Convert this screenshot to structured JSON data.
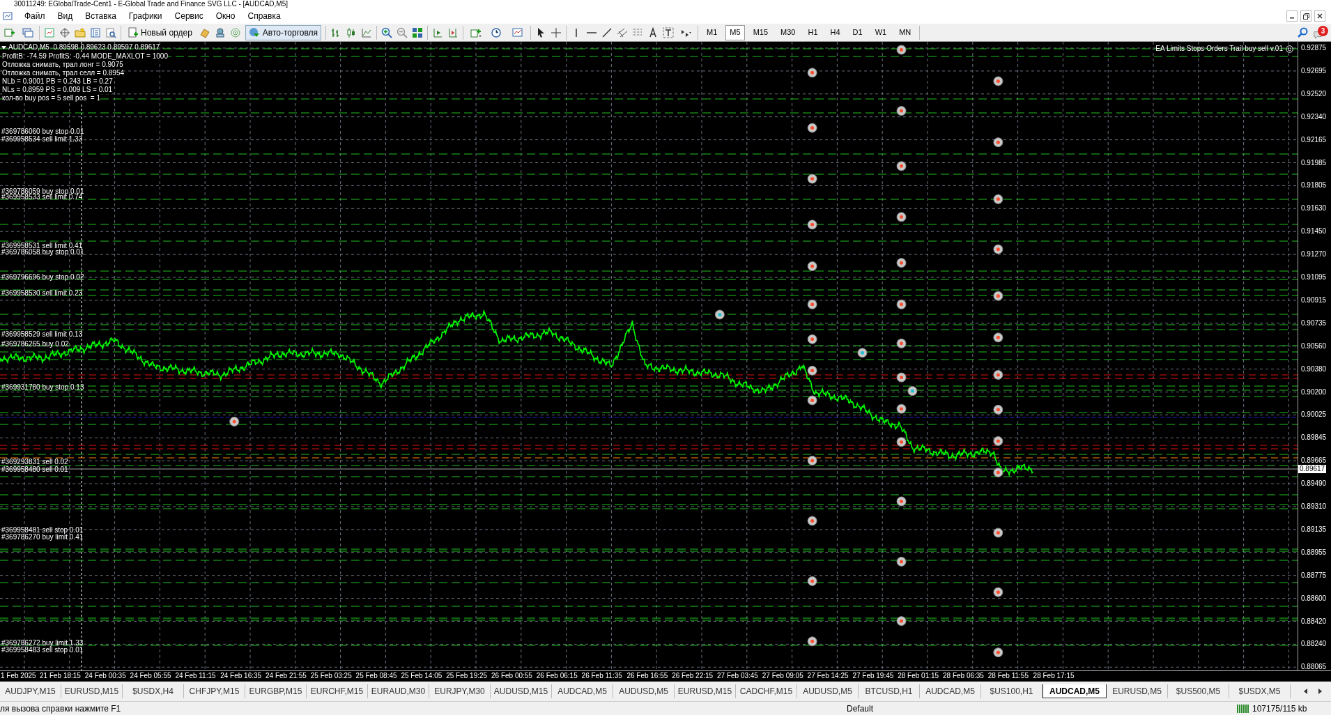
{
  "window": {
    "title": "30011249: EGlobalTrade-Cent1 - E-Global Trade and Finance SVG LLC - [AUDCAD,M5]"
  },
  "menu": [
    "Файл",
    "Вид",
    "Вставка",
    "Графики",
    "Сервис",
    "Окно",
    "Справка"
  ],
  "toolbar": {
    "new_order": "Новый ордер",
    "auto_trading": "Авто-торговля",
    "notifications": "3",
    "timeframes": [
      {
        "label": "M1",
        "selected": false
      },
      {
        "label": "M5",
        "selected": true
      },
      {
        "label": "M15",
        "selected": false
      },
      {
        "label": "M30",
        "selected": false
      },
      {
        "label": "H1",
        "selected": false
      },
      {
        "label": "H4",
        "selected": false
      },
      {
        "label": "D1",
        "selected": false
      },
      {
        "label": "W1",
        "selected": false
      },
      {
        "label": "MN",
        "selected": false
      }
    ]
  },
  "chart": {
    "symbol_line": "AUDCAD,M5  0.89598 0.89623 0.89597 0.89617",
    "info_lines": [
      "ProfitB: -74.59 ProfitS: -0.44 MODE_MAXLOT = 1000",
      "Отложка снимать, трал лонг = 0.9075",
      "Отложка снимать, трал селл = 0.8954",
      "NLb = 0.9001 PB = 0.243 LB = 0.27",
      "NLs = 0.8959 PS = 0.009 LS = 0.01",
      "кол-во buy pos = 5 sell pos  = 1"
    ],
    "expert": "EA Limits Stops Orders Trail buy sell v.01",
    "order_labels": [
      "#369786060 buy stop 0.01",
      "#369958534 sell limit 1.33",
      "#369786059 buy stop 0.01",
      "#369958533 sell limit 0.74",
      "#369958531 sell limit 0.41",
      "#369786058 buy stop 0.01",
      "#369796696 buy stop 0.02",
      "#369958530 sell limit 0.23",
      "#369958529 sell limit 0.13",
      "#369786265 buy 0.02",
      "#369931780 buy stop 0.13",
      "#369293831 sell 0.02",
      "#369958480 sell 0.01",
      "#369958481 sell stop 0.01",
      "#369786270 buy limit 0.41",
      "#369786272 buy limit 1.33",
      "#369958483 sell stop 0.01"
    ],
    "price_scale": [
      "0.92875",
      "0.92695",
      "0.92520",
      "0.92340",
      "0.92165",
      "0.91985",
      "0.91805",
      "0.91630",
      "0.91450",
      "0.91270",
      "0.91095",
      "0.90915",
      "0.90735",
      "0.90560",
      "0.90380",
      "0.90200",
      "0.90025",
      "0.89845",
      "0.89665",
      "0.89490",
      "0.89310",
      "0.89135",
      "0.88955",
      "0.88775",
      "0.88600",
      "0.88420",
      "0.88240",
      "0.88065"
    ],
    "current_price": "0.89617",
    "time_scale": [
      "1 Feb 2025",
      "21 Feb 18:15",
      "24 Feb 00:35",
      "24 Feb 05:55",
      "24 Feb 11:15",
      "24 Feb 16:35",
      "24 Feb 21:55",
      "25 Feb 03:25",
      "25 Feb 08:45",
      "25 Feb 14:05",
      "25 Feb 19:25",
      "26 Feb 00:55",
      "26 Feb 06:15",
      "26 Feb 11:35",
      "26 Feb 16:55",
      "26 Feb 22:15",
      "27 Feb 03:45",
      "27 Feb 09:05",
      "27 Feb 14:25",
      "27 Feb 19:45",
      "28 Feb 01:15",
      "28 Feb 06:35",
      "28 Feb 11:55",
      "28 Feb 17:15"
    ]
  },
  "symbol_tabs": [
    {
      "label": "AUDJPY,M15",
      "selected": false
    },
    {
      "label": "EURUSD,M15",
      "selected": false
    },
    {
      "label": "$USDX,H4",
      "selected": false
    },
    {
      "label": "CHFJPY,M15",
      "selected": false
    },
    {
      "label": "EURGBP,M15",
      "selected": false
    },
    {
      "label": "EURCHF,M15",
      "selected": false
    },
    {
      "label": "EURAUD,M30",
      "selected": false
    },
    {
      "label": "EURJPY,M30",
      "selected": false
    },
    {
      "label": "AUDUSD,M15",
      "selected": false
    },
    {
      "label": "AUDCAD,M5",
      "selected": false
    },
    {
      "label": "AUDUSD,M5",
      "selected": false
    },
    {
      "label": "EURUSD,M15",
      "selected": false
    },
    {
      "label": "CADCHF,M15",
      "selected": false
    },
    {
      "label": "AUDUSD,M5",
      "selected": false
    },
    {
      "label": "BTCUSD,H1",
      "selected": false
    },
    {
      "label": "AUDCAD,M5",
      "selected": false
    },
    {
      "label": "$US100,H1",
      "selected": false
    },
    {
      "label": "AUDCAD,M5",
      "selected": true
    },
    {
      "label": "EURUSD,M5",
      "selected": false
    },
    {
      "label": "$US500,M5",
      "selected": false
    },
    {
      "label": "$USDX,M5",
      "selected": false
    }
  ],
  "status_bar": {
    "help": "ля вызова справки нажмите F1",
    "profile": "Default",
    "traffic": "107175/115 kb"
  }
}
